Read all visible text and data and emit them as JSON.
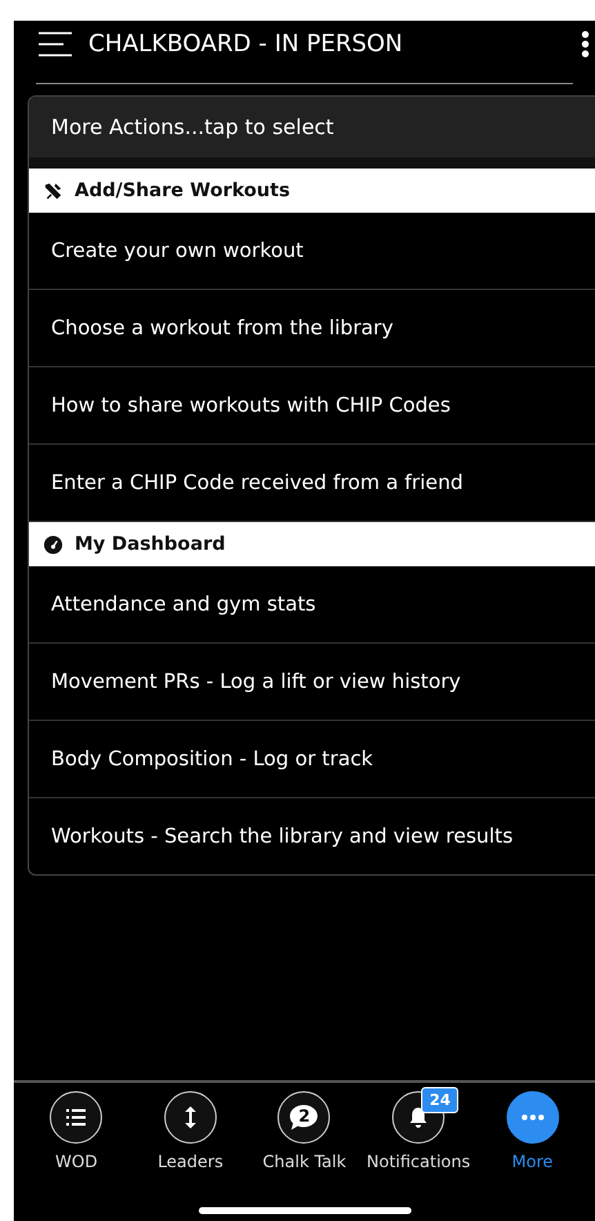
{
  "header": {
    "title": "CHALKBOARD - IN PERSON"
  },
  "actions": {
    "title": "More Actions...tap to select",
    "sections": [
      {
        "title": "Add/Share Workouts",
        "items": [
          "Create your own workout",
          "Choose a workout from the library",
          "How to share workouts with CHIP Codes",
          "Enter a CHIP Code received from a friend"
        ]
      },
      {
        "title": "My Dashboard",
        "items": [
          "Attendance and gym stats",
          "Movement PRs - Log a lift or view history",
          "Body Composition - Log or track",
          "Workouts - Search the library and view results"
        ]
      }
    ]
  },
  "tabs": [
    {
      "label": "WOD",
      "selected": false
    },
    {
      "label": "Leaders",
      "selected": false
    },
    {
      "label": "Chalk Talk",
      "count": "2",
      "selected": false
    },
    {
      "label": "Notifications",
      "badge": "24",
      "selected": false
    },
    {
      "label": "More",
      "selected": true
    }
  ]
}
